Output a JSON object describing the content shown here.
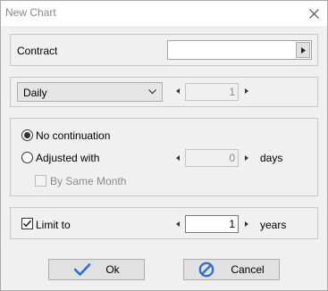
{
  "window": {
    "title": "New Chart"
  },
  "contract": {
    "label": "Contract",
    "value": ""
  },
  "period": {
    "selected": "Daily",
    "count_value": "1"
  },
  "continuation": {
    "no_continuation_label": "No continuation",
    "adjusted_with_label": "Adjusted with",
    "adjusted_days_value": "0",
    "days_unit": "days",
    "by_same_month_label": "By Same Month",
    "selected_option": "No continuation"
  },
  "limit": {
    "label": "Limit to",
    "checked": true,
    "value": "1",
    "unit": "years"
  },
  "buttons": {
    "ok_label": "Ok",
    "cancel_label": "Cancel"
  },
  "icons": {
    "close": "close-icon",
    "ok": "check-icon",
    "cancel": "cancel-icon"
  },
  "colors": {
    "accent": "#2b6fd1"
  }
}
